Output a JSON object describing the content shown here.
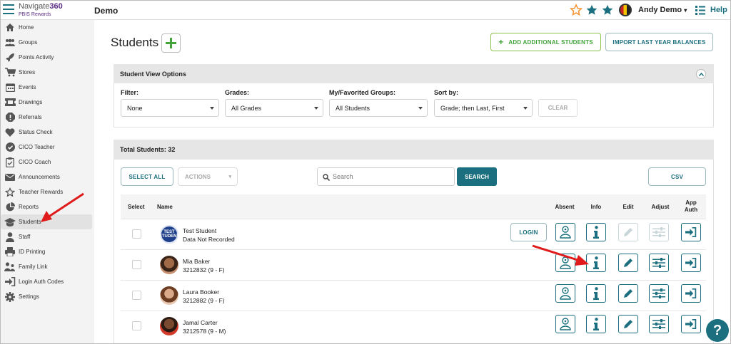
{
  "app": {
    "brand_pre": "Navigate",
    "brand_num": "360",
    "brand_sub": "PBIS Rewards",
    "page": "Demo",
    "user": "Andy Demo",
    "help": "Help"
  },
  "colors": {
    "teal": "#1b6f7e",
    "green": "#43a33b",
    "orange": "#f59331",
    "purple": "#5b2c83"
  },
  "sidebar": {
    "items": [
      {
        "label": "Home",
        "icon": "home-icon"
      },
      {
        "label": "Groups",
        "icon": "groups-icon"
      },
      {
        "label": "Points Activity",
        "icon": "rocket-icon"
      },
      {
        "label": "Stores",
        "icon": "cart-icon"
      },
      {
        "label": "Events",
        "icon": "calendar-icon"
      },
      {
        "label": "Drawings",
        "icon": "ticket-icon"
      },
      {
        "label": "Referrals",
        "icon": "alert-icon"
      },
      {
        "label": "Status Check",
        "icon": "heart-icon"
      },
      {
        "label": "CICO Teacher",
        "icon": "check-circle-icon"
      },
      {
        "label": "CICO Coach",
        "icon": "clipboard-icon"
      },
      {
        "label": "Announcements",
        "icon": "envelope-icon"
      },
      {
        "label": "Teacher Rewards",
        "icon": "star-outline-icon"
      },
      {
        "label": "Reports",
        "icon": "pie-chart-icon"
      },
      {
        "label": "Students",
        "icon": "graduation-cap-icon",
        "active": true
      },
      {
        "label": "Staff",
        "icon": "person-icon"
      },
      {
        "label": "ID Printing",
        "icon": "printer-icon"
      },
      {
        "label": "Family Link",
        "icon": "family-icon"
      },
      {
        "label": "Login Auth Codes",
        "icon": "sign-in-icon"
      },
      {
        "label": "Settings",
        "icon": "gear-icon"
      }
    ]
  },
  "main": {
    "title": "Students",
    "add_additional": "ADD ADDITIONAL STUDENTS",
    "import_balances": "IMPORT LAST YEAR BALANCES",
    "view_options": "Student View Options",
    "filters": {
      "filter_label": "Filter:",
      "filter_value": "None",
      "grades_label": "Grades:",
      "grades_value": "All Grades",
      "groups_label": "My/Favorited Groups:",
      "groups_value": "All Students",
      "sort_label": "Sort by:",
      "sort_value": "Grade; then Last, First",
      "clear": "CLEAR"
    },
    "total": "Total Students: 32",
    "select_all": "SELECT ALL",
    "actions": "ACTIONS",
    "search_placeholder": "Search",
    "search_button": "SEARCH",
    "csv": "CSV",
    "columns": {
      "select": "Select",
      "name": "Name",
      "absent": "Absent",
      "info": "Info",
      "edit": "Edit",
      "adjust": "Adjust",
      "app_auth": "App Auth"
    },
    "login": "LOGIN",
    "test_badge": "TEST STUDENT",
    "students": [
      {
        "name": "Test Student",
        "detail": "Data Not Recorded"
      },
      {
        "name": "Mia Baker",
        "detail": "3212832 (9 - F)"
      },
      {
        "name": "Laura Booker",
        "detail": "3212882 (9 - F)"
      },
      {
        "name": "Jamal Carter",
        "detail": "3212578 (9 - M)"
      }
    ]
  }
}
